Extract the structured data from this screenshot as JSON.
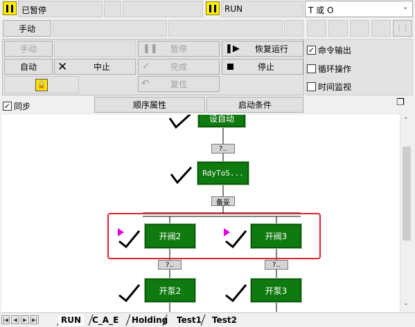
{
  "status_bar": {
    "state_text": "已暂停",
    "mode_text": "RUN",
    "combo_value": "T 或 O"
  },
  "manual_row": {
    "manual_label": "手动"
  },
  "mode_buttons": {
    "manual": "手动",
    "auto": "自动"
  },
  "control_buttons": {
    "pause": "暂停",
    "resume": "恢复运行",
    "abort": "中止",
    "complete": "完成",
    "stop": "停止",
    "reset": "复位"
  },
  "options": {
    "command_output": "命令输出",
    "command_output_checked": true,
    "loop": "循环操作",
    "loop_checked": false,
    "time_monitor": "时间监视",
    "time_monitor_checked": false
  },
  "bar3": {
    "sync": "同步",
    "sync_checked": true,
    "seq_props": "顺序属性",
    "start_cond": "启动条件"
  },
  "steps": {
    "set_auto": "设自动",
    "rdytos": "RdyToS...",
    "open_valve2": "开阀2",
    "open_valve3": "开阀3",
    "open_pump2": "开泵2",
    "open_pump3": "开泵3"
  },
  "transitions": {
    "t1": "?..",
    "t2": "备妥",
    "t3": "?..",
    "t4": "?.."
  },
  "tabs": [
    "RUN",
    "C_A_E",
    "Holding",
    "Test1",
    "Test2"
  ],
  "colors": {
    "step_green": "#0f7a0f",
    "highlight_red": "#e0202a",
    "pause_yellow": "#ffef00",
    "marker_magenta": "#e000e0"
  }
}
